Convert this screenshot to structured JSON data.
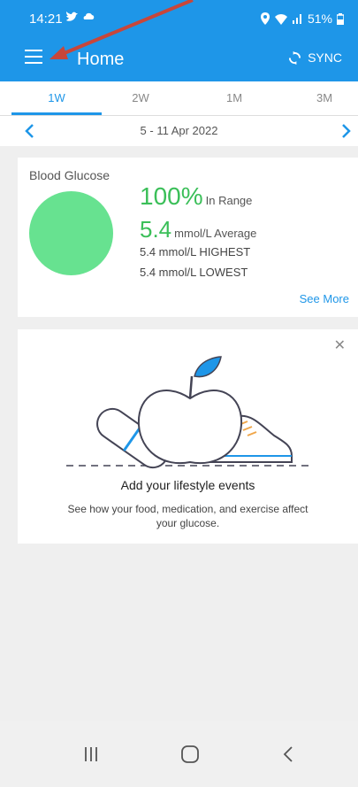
{
  "status_bar": {
    "time": "14:21",
    "battery": "51%"
  },
  "header": {
    "title": "Home",
    "sync_label": "SYNC"
  },
  "tabs": [
    {
      "label": "1W",
      "active": true
    },
    {
      "label": "2W",
      "active": false
    },
    {
      "label": "1M",
      "active": false
    },
    {
      "label": "3M",
      "active": false
    }
  ],
  "date_range": "5 - 11 Apr 2022",
  "glucose": {
    "title": "Blood Glucose",
    "in_range_value": "100%",
    "in_range_label": "In Range",
    "average_value": "5.4",
    "average_label": "mmol/L Average",
    "highest": "5.4 mmol/L HIGHEST",
    "lowest": "5.4 mmol/L LOWEST",
    "see_more": "See More"
  },
  "lifestyle": {
    "title": "Add your lifestyle events",
    "subtitle": "See how your food, medication, and exercise affect your glucose."
  },
  "colors": {
    "accent": "#1e96e8",
    "in_range": "#3bbf59",
    "circle": "#67e290",
    "annotation_arrow": "#c8463a"
  }
}
